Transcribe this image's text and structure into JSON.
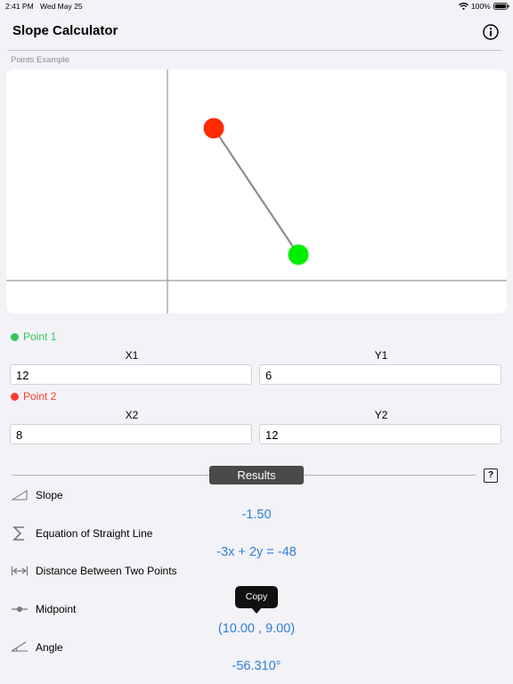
{
  "status_bar": {
    "time": "2:41 PM",
    "date": "Wed May 25",
    "battery": "100%"
  },
  "header": {
    "title": "Slope Calculator",
    "info_icon": "info-circle-icon"
  },
  "graph": {
    "section_label": "Points Example",
    "point1_color": "#ff2a00",
    "point2_color": "#00ee00",
    "line_color": "#8c8c8c",
    "axis_color": "#9a9a9a"
  },
  "point1": {
    "label": "Point 1",
    "color": "#34c759",
    "x_header": "X1",
    "y_header": "Y1",
    "x_value": "12",
    "y_value": "6"
  },
  "point2": {
    "label": "Point 2",
    "color": "#ff3b30",
    "x_header": "X2",
    "y_header": "Y2",
    "x_value": "8",
    "y_value": "12"
  },
  "results": {
    "title": "Results",
    "help_label": "?",
    "accent_color": "#2f7fd4",
    "rows": [
      {
        "label": "Slope",
        "value": "-1.50",
        "icon": "slope-triangle-icon"
      },
      {
        "label": "Equation of Straight Line",
        "value": "-3x + 2y = -48",
        "icon": "sigma-icon"
      },
      {
        "label": "Distance Between Two Points",
        "value": "",
        "icon": "distance-arrows-icon"
      },
      {
        "label": "Midpoint",
        "value": "(10.00 , 9.00)",
        "icon": "midpoint-icon"
      },
      {
        "label": "Angle",
        "value": "-56.310°",
        "icon": "angle-icon"
      }
    ]
  },
  "tooltip": {
    "label": "Copy"
  }
}
